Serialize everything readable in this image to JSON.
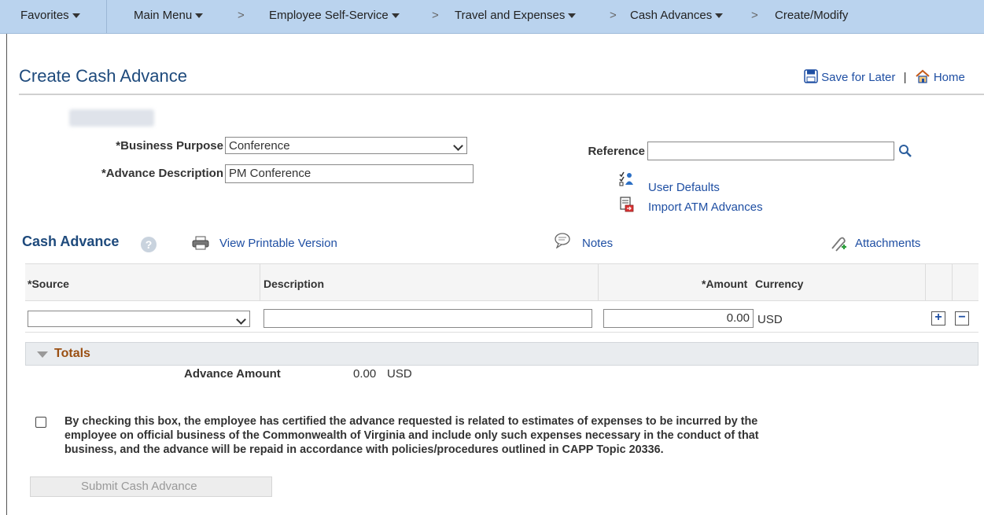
{
  "nav": {
    "favorites": "Favorites",
    "main_menu": "Main Menu",
    "employee_self_service": "Employee Self-Service",
    "travel_expenses": "Travel and Expenses",
    "cash_advances": "Cash Advances",
    "current": "Create/Modify",
    "separator": ">"
  },
  "page": {
    "title": "Create Cash Advance",
    "save_for_later": "Save for Later",
    "link_divider": "|",
    "home": "Home"
  },
  "form": {
    "business_purpose_label": "*Business Purpose",
    "business_purpose_value": "Conference",
    "advance_description_label": "*Advance Description",
    "advance_description_value": "PM Conference",
    "reference_label": "Reference",
    "reference_value": "",
    "user_defaults": "User Defaults",
    "import_atm": "Import ATM Advances"
  },
  "cash_advance": {
    "title": "Cash Advance",
    "help": "?",
    "view_printable": "View Printable Version",
    "notes": "Notes",
    "attachments": "Attachments",
    "columns": {
      "source": "*Source",
      "description": "Description",
      "amount": "*Amount",
      "currency": "Currency"
    },
    "row": {
      "source": "",
      "description": "",
      "amount": "0.00",
      "currency": "USD"
    }
  },
  "totals": {
    "title": "Totals",
    "advance_amount_label": "Advance Amount",
    "advance_amount_value": "0.00",
    "currency": "USD"
  },
  "certification": {
    "text": "By checking this box, the employee has certified the advance requested is related to estimates of expenses to be incurred by the employee on official business of the Commonwealth of Virginia and include only such expenses necessary in the conduct of that business, and the advance will be repaid in accordance with policies/procedures outlined in CAPP Topic 20336.",
    "checked": false
  },
  "submit_label": "Submit Cash Advance"
}
